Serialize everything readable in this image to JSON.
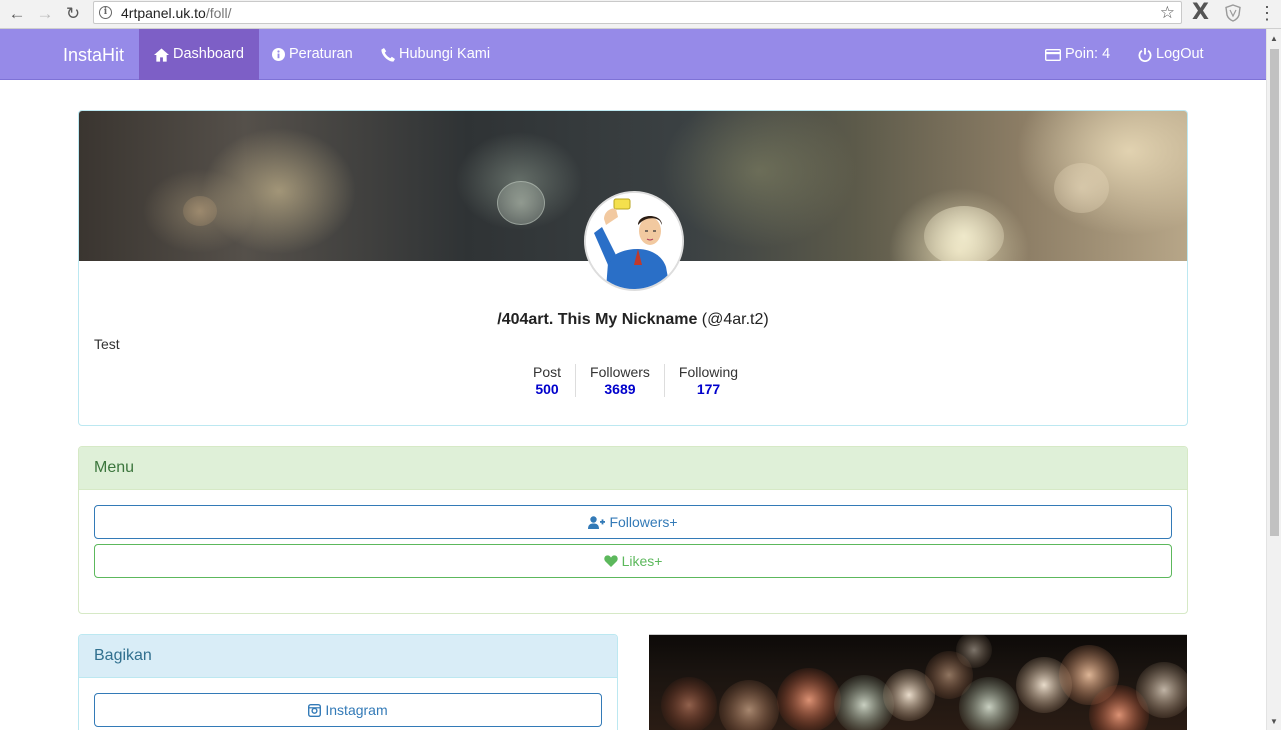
{
  "browser": {
    "url_host": "4rtpanel.uk.to",
    "url_path": "/foll/"
  },
  "navbar": {
    "brand": "InstaHit",
    "items": [
      {
        "label": "Dashboard",
        "icon": "home-icon",
        "active": true
      },
      {
        "label": "Peraturan",
        "icon": "info-icon",
        "active": false
      },
      {
        "label": "Hubungi Kami",
        "icon": "phone-icon",
        "active": false
      }
    ],
    "points_label": "Poin: 4",
    "logout_label": "LogOut"
  },
  "profile": {
    "display_name": "/404art. This My Nickname",
    "username": "(@4ar.t2)",
    "bio": "Test",
    "stats": [
      {
        "label": "Post",
        "value": "500"
      },
      {
        "label": "Followers",
        "value": "3689"
      },
      {
        "label": "Following",
        "value": "177"
      }
    ]
  },
  "menu": {
    "title": "Menu",
    "followers_button": "Followers+",
    "likes_button": "Likes+"
  },
  "share": {
    "title": "Bagikan",
    "instagram_button": "Instagram"
  },
  "colors": {
    "navbar": "#968ae8",
    "navbar_active": "#7d5fc6",
    "stat_value": "#0000cc",
    "primary": "#337ab7",
    "success": "#5cb85c"
  }
}
